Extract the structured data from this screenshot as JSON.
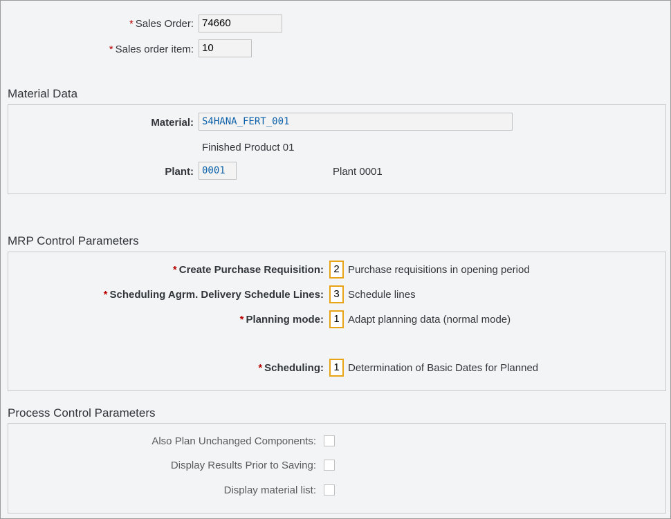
{
  "header_fields": {
    "sales_order": {
      "label": "Sales Order:",
      "value": "74660"
    },
    "sales_order_item": {
      "label": "Sales order item:",
      "value": "10"
    }
  },
  "material_data": {
    "title": "Material Data",
    "material": {
      "label": "Material:",
      "value": "S4HANA_FERT_001",
      "description": "Finished Product 01"
    },
    "plant": {
      "label": "Plant:",
      "value": "0001",
      "description": "Plant 0001"
    }
  },
  "mrp_control": {
    "title": "MRP Control Parameters",
    "create_pr": {
      "label": "Create Purchase Requisition:",
      "code": "2",
      "description": "Purchase requisitions in opening period"
    },
    "sched_agrm": {
      "label": "Scheduling Agrm. Delivery Schedule Lines:",
      "code": "3",
      "description": "Schedule lines"
    },
    "planning_mode": {
      "label": "Planning mode:",
      "code": "1",
      "description": "Adapt planning data (normal mode)"
    },
    "scheduling": {
      "label": "Scheduling:",
      "code": "1",
      "description": "Determination of Basic Dates for Planned"
    }
  },
  "process_control": {
    "title": "Process Control Parameters",
    "also_plan": {
      "label": "Also Plan Unchanged Components:",
      "checked": false
    },
    "display_results": {
      "label": "Display Results Prior to Saving:",
      "checked": false
    },
    "display_material_list": {
      "label": "Display material list:",
      "checked": false
    }
  },
  "required_marker": "*"
}
